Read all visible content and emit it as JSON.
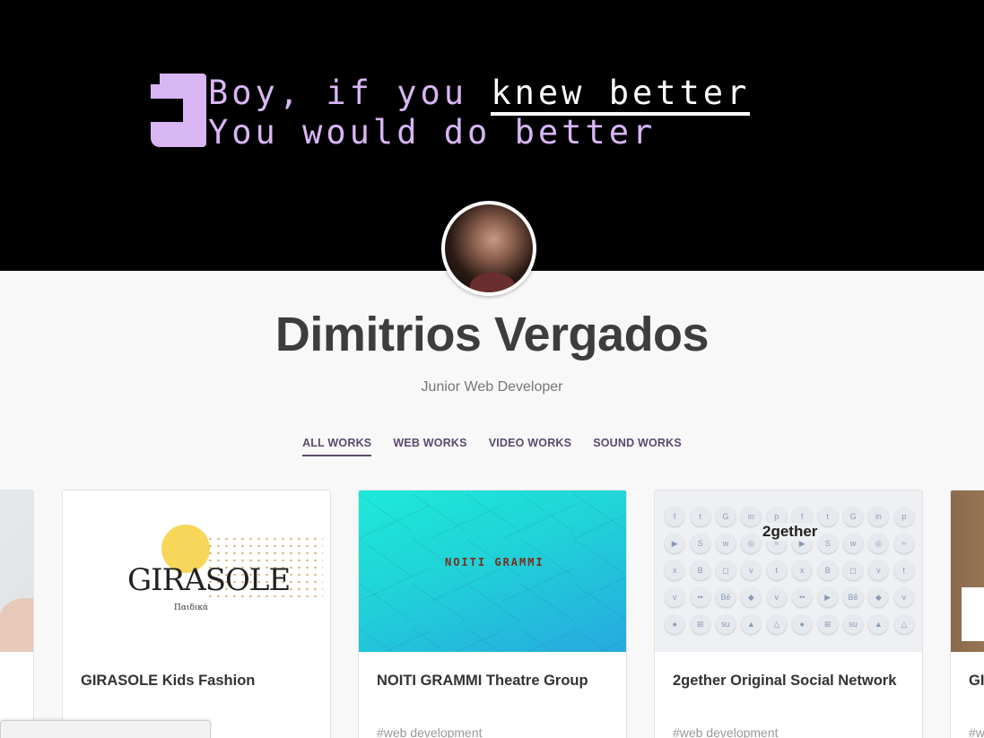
{
  "hero": {
    "line1_prefix": "Boy, if you ",
    "line1_highlight": "knew better",
    "line2": "You would do better"
  },
  "profile": {
    "name": "Dimitrios Vergados",
    "role": "Junior Web Developer"
  },
  "tabs": [
    {
      "label": "ALL WORKS",
      "active": true
    },
    {
      "label": "WEB WORKS",
      "active": false
    },
    {
      "label": "VIDEO WORKS",
      "active": false
    },
    {
      "label": "SOUND WORKS",
      "active": false
    }
  ],
  "cards": [
    {
      "title": "",
      "tag": ""
    },
    {
      "title": "GIRASOLE Kids Fashion",
      "tag": "",
      "image_text": "GIRASOLE",
      "image_subtext": "Παιδικά"
    },
    {
      "title": "NOITI GRAMMI Theatre Group",
      "tag": "#web development",
      "image_text": "NOITI GRAMMI"
    },
    {
      "title": "2gether Original Social Network",
      "tag": "#web development",
      "image_text": "2gether"
    },
    {
      "title": "GI",
      "tag": "#w"
    }
  ],
  "colors": {
    "hero_bg": "#000000",
    "hero_text": "#d8b6f4",
    "tab_accent": "#5a4a6e",
    "name_text": "#3d3d3d"
  }
}
